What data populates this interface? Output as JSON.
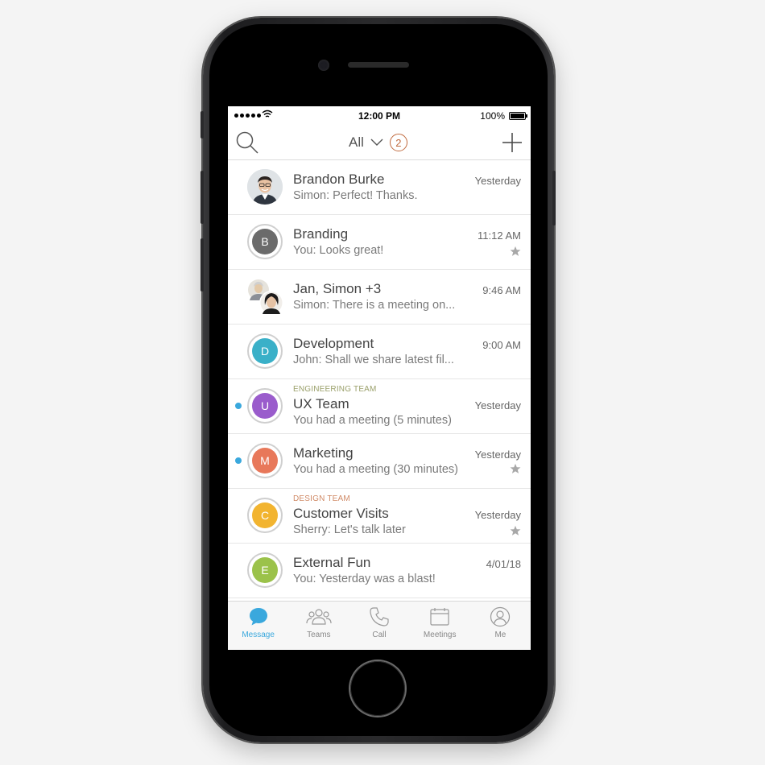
{
  "statusbar": {
    "time": "12:00 PM",
    "battery": "100%"
  },
  "header": {
    "filter_label": "All",
    "filter_count": "2"
  },
  "colors": {
    "accent": "#3aa8dd",
    "badge": "#c06a3e",
    "team_engineering": "#9aa06a",
    "team_design": "#d08a66"
  },
  "conversations": [
    {
      "name": "Brandon Burke",
      "preview": "Simon: Perfect! Thanks.",
      "time": "Yesterday",
      "avatar_type": "photo",
      "starred": false,
      "unread": false
    },
    {
      "name": "Branding",
      "preview": "You: Looks great!",
      "time": "11:12 AM",
      "avatar_letter": "B",
      "avatar_color": "#6b6b6b",
      "starred": true,
      "unread": false
    },
    {
      "name": "Jan, Simon +3",
      "preview": "Simon: There is a meeting on...",
      "time": "9:46 AM",
      "avatar_type": "group",
      "starred": false,
      "unread": false
    },
    {
      "name": "Development",
      "preview": "John: Shall we share latest fil...",
      "time": "9:00 AM",
      "avatar_letter": "D",
      "avatar_color": "#3ab0c8",
      "starred": false,
      "unread": false
    },
    {
      "team": "ENGINEERING TEAM",
      "name": "UX Team",
      "preview": "You had a meeting (5 minutes)",
      "time": "Yesterday",
      "avatar_letter": "U",
      "avatar_color": "#9a5ccc",
      "starred": false,
      "unread": true
    },
    {
      "name": "Marketing",
      "preview": "You had a meeting (30 minutes)",
      "time": "Yesterday",
      "avatar_letter": "M",
      "avatar_color": "#e8785a",
      "starred": true,
      "unread": true
    },
    {
      "team": "DESIGN TEAM",
      "name": "Customer Visits",
      "preview": "Sherry: Let's talk later",
      "time": "Yesterday",
      "avatar_letter": "C",
      "avatar_color": "#f2b430",
      "starred": true,
      "unread": false
    },
    {
      "name": "External Fun",
      "preview": "You: Yesterday was a blast!",
      "time": "4/01/18",
      "avatar_letter": "E",
      "avatar_color": "#9bc24a",
      "starred": false,
      "unread": false
    }
  ],
  "tabs": [
    {
      "label": "Message",
      "icon": "message-icon",
      "active": true
    },
    {
      "label": "Teams",
      "icon": "teams-icon",
      "active": false
    },
    {
      "label": "Call",
      "icon": "call-icon",
      "active": false
    },
    {
      "label": "Meetings",
      "icon": "meetings-icon",
      "active": false
    },
    {
      "label": "Me",
      "icon": "me-icon",
      "active": false
    }
  ]
}
